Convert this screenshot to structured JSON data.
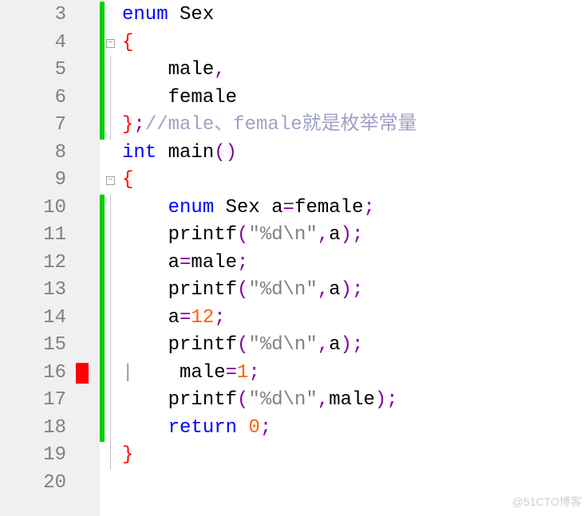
{
  "watermark": "@51CTO博客",
  "lines": [
    {
      "num": "3",
      "marker": "",
      "change": true,
      "fold": "",
      "tokens": [
        {
          "t": "kw",
          "v": "enum"
        },
        {
          "t": "sp",
          "v": " "
        },
        {
          "t": "type",
          "v": "Sex"
        }
      ]
    },
    {
      "num": "4",
      "marker": "",
      "change": true,
      "fold": "box",
      "foldLine": true,
      "tokens": [
        {
          "t": "brace-open",
          "v": "{"
        }
      ],
      "indent": ""
    },
    {
      "num": "5",
      "marker": "",
      "change": true,
      "fold": "line",
      "tokens": [
        {
          "t": "id",
          "v": "male"
        },
        {
          "t": "comma",
          "v": ","
        }
      ],
      "indent": "    "
    },
    {
      "num": "6",
      "marker": "",
      "change": true,
      "fold": "line",
      "tokens": [
        {
          "t": "id",
          "v": "female"
        }
      ],
      "indent": "    "
    },
    {
      "num": "7",
      "marker": "",
      "change": true,
      "fold": "end",
      "tokens": [
        {
          "t": "brace-close",
          "v": "}"
        },
        {
          "t": "semicolon",
          "v": ";"
        },
        {
          "t": "comment",
          "v": "//male、female就是枚举常量"
        }
      ],
      "indent": ""
    },
    {
      "num": "8",
      "marker": "",
      "change": false,
      "fold": "",
      "tokens": [
        {
          "t": "kw",
          "v": "int"
        },
        {
          "t": "sp",
          "v": " "
        },
        {
          "t": "fn",
          "v": "main"
        },
        {
          "t": "paren",
          "v": "()"
        }
      ]
    },
    {
      "num": "9",
      "marker": "",
      "change": false,
      "fold": "box",
      "tokens": [
        {
          "t": "brace-open",
          "v": "{"
        }
      ],
      "indent": ""
    },
    {
      "num": "10",
      "marker": "",
      "change": true,
      "fold": "line",
      "tokens": [
        {
          "t": "kw",
          "v": "enum"
        },
        {
          "t": "sp",
          "v": " "
        },
        {
          "t": "type",
          "v": "Sex"
        },
        {
          "t": "sp",
          "v": " "
        },
        {
          "t": "id",
          "v": "a"
        },
        {
          "t": "eq",
          "v": "="
        },
        {
          "t": "id",
          "v": "female"
        },
        {
          "t": "semicolon",
          "v": ";"
        }
      ],
      "indent": "    "
    },
    {
      "num": "11",
      "marker": "",
      "change": true,
      "fold": "line",
      "tokens": [
        {
          "t": "fn",
          "v": "printf"
        },
        {
          "t": "paren",
          "v": "("
        },
        {
          "t": "str",
          "v": "\"%d\\n\""
        },
        {
          "t": "comma",
          "v": ","
        },
        {
          "t": "id",
          "v": "a"
        },
        {
          "t": "paren",
          "v": ")"
        },
        {
          "t": "semicolon",
          "v": ";"
        }
      ],
      "indent": "    "
    },
    {
      "num": "12",
      "marker": "",
      "change": true,
      "fold": "line",
      "tokens": [
        {
          "t": "id",
          "v": "a"
        },
        {
          "t": "eq",
          "v": "="
        },
        {
          "t": "id",
          "v": "male"
        },
        {
          "t": "semicolon",
          "v": ";"
        }
      ],
      "indent": "    "
    },
    {
      "num": "13",
      "marker": "",
      "change": true,
      "fold": "line",
      "tokens": [
        {
          "t": "fn",
          "v": "printf"
        },
        {
          "t": "paren",
          "v": "("
        },
        {
          "t": "str",
          "v": "\"%d\\n\""
        },
        {
          "t": "comma",
          "v": ","
        },
        {
          "t": "id",
          "v": "a"
        },
        {
          "t": "paren",
          "v": ")"
        },
        {
          "t": "semicolon",
          "v": ";"
        }
      ],
      "indent": "    "
    },
    {
      "num": "14",
      "marker": "",
      "change": true,
      "fold": "line",
      "tokens": [
        {
          "t": "id",
          "v": "a"
        },
        {
          "t": "eq",
          "v": "="
        },
        {
          "t": "num",
          "v": "12"
        },
        {
          "t": "semicolon",
          "v": ";"
        }
      ],
      "indent": "    "
    },
    {
      "num": "15",
      "marker": "",
      "change": true,
      "fold": "line",
      "tokens": [
        {
          "t": "fn",
          "v": "printf"
        },
        {
          "t": "paren",
          "v": "("
        },
        {
          "t": "str",
          "v": "\"%d\\n\""
        },
        {
          "t": "comma",
          "v": ","
        },
        {
          "t": "id",
          "v": "a"
        },
        {
          "t": "paren",
          "v": ")"
        },
        {
          "t": "semicolon",
          "v": ";"
        }
      ],
      "indent": "    "
    },
    {
      "num": "16",
      "marker": "red",
      "change": true,
      "fold": "line",
      "cursor": true,
      "tokens": [
        {
          "t": "id",
          "v": "male"
        },
        {
          "t": "eq",
          "v": "="
        },
        {
          "t": "num",
          "v": "1"
        },
        {
          "t": "semicolon",
          "v": ";"
        }
      ],
      "indent": "    "
    },
    {
      "num": "17",
      "marker": "",
      "change": true,
      "fold": "line",
      "tokens": [
        {
          "t": "fn",
          "v": "printf"
        },
        {
          "t": "paren",
          "v": "("
        },
        {
          "t": "str",
          "v": "\"%d\\n\""
        },
        {
          "t": "comma",
          "v": ","
        },
        {
          "t": "id",
          "v": "male"
        },
        {
          "t": "paren",
          "v": ")"
        },
        {
          "t": "semicolon",
          "v": ";"
        }
      ],
      "indent": "    "
    },
    {
      "num": "18",
      "marker": "",
      "change": true,
      "fold": "line",
      "tokens": [
        {
          "t": "kw",
          "v": "return"
        },
        {
          "t": "sp",
          "v": " "
        },
        {
          "t": "num",
          "v": "0"
        },
        {
          "t": "semicolon",
          "v": ";"
        }
      ],
      "indent": "    "
    },
    {
      "num": "19",
      "marker": "",
      "change": false,
      "fold": "end",
      "tokens": [
        {
          "t": "brace-close",
          "v": "}"
        }
      ],
      "indent": ""
    },
    {
      "num": "20",
      "marker": "",
      "change": false,
      "fold": "",
      "tokens": []
    }
  ]
}
